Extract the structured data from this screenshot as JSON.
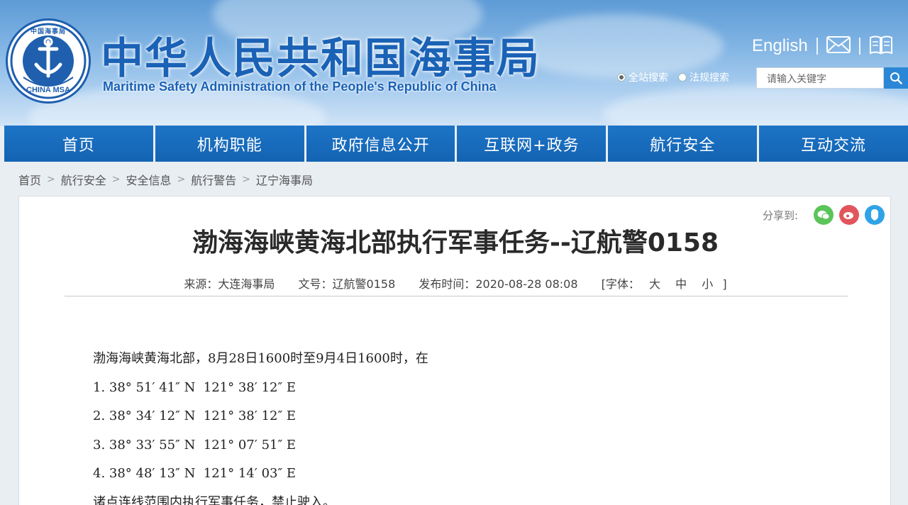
{
  "header": {
    "logo_text": "中国海事局",
    "logo_caption": "CHINA MSA",
    "title": "中华人民共和国海事局",
    "subtitle": "Maritime Safety Administration of the People's Republic of China",
    "english_link": "English",
    "mail_icon": "mail-icon",
    "book_icon": "book-icon",
    "search_scopes": [
      {
        "label": "全站搜索",
        "selected": true
      },
      {
        "label": "法规搜索",
        "selected": false
      }
    ],
    "search_placeholder": "请输入关键字",
    "search_icon": "search-icon"
  },
  "nav": {
    "items": [
      "首页",
      "机构职能",
      "政府信息公开",
      "互联网+政务",
      "航行安全",
      "互动交流"
    ]
  },
  "breadcrumb": [
    "首页",
    "航行安全",
    "安全信息",
    "航行警告",
    "辽宁海事局"
  ],
  "article": {
    "share_label": "分享到:",
    "share_icons": [
      "wechat-icon",
      "weibo-icon",
      "qq-icon"
    ],
    "title": "渤海海峡黄海北部执行军事任务--辽航警0158",
    "meta": {
      "source": "来源：大连海事局",
      "doc_no": "文号：辽航警0158",
      "published": "发布时间：2020-08-28 08:08",
      "font_label": "[字体：",
      "font_large": "大",
      "font_medium": "中",
      "font_small": "小",
      "font_close": "]"
    },
    "lines": [
      "渤海海峡黄海北部，8月28日1600时至9月4日1600时，在",
      "1. 38° 51′ 41″ N  121° 38′ 12″ E",
      "2. 38° 34′ 12″ N  121° 38′ 12″ E",
      "3. 38° 33′ 55″ N  121° 07′ 51″ E",
      "4. 38° 48′ 13″ N  121° 14′ 03″ E",
      "诸点连线范围内执行军事任务，禁止驶入。"
    ]
  },
  "colors": {
    "brand_blue": "#1a62b6",
    "nav_blue": "#1463b3",
    "search_button": "#2b87d6",
    "wechat": "#5cc45a",
    "weibo": "#e2555c",
    "qq": "#2fa3e6"
  }
}
